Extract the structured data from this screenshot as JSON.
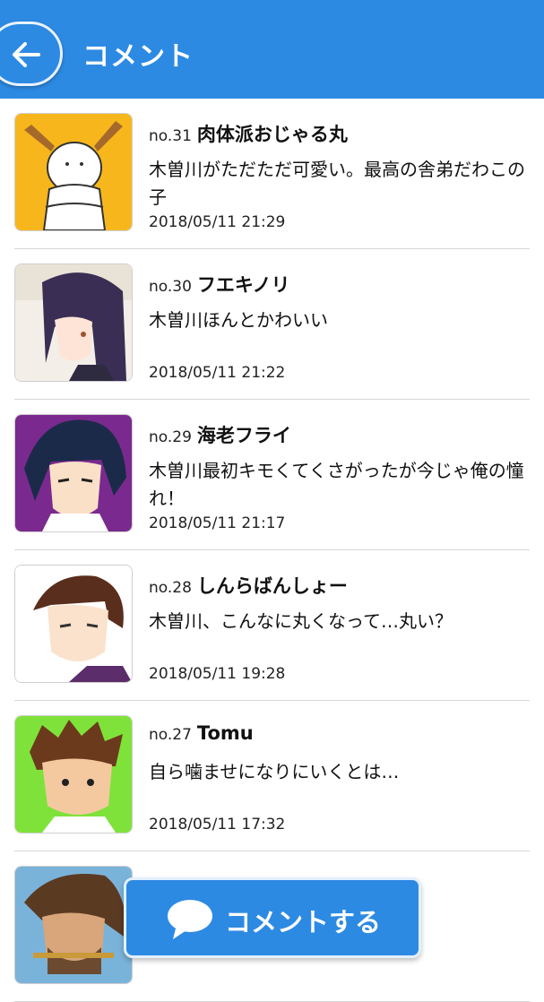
{
  "header": {
    "title": "コメント",
    "color": "#2d8ae3"
  },
  "comments": [
    {
      "number": "no.31",
      "user": "肉体派おじゃる丸",
      "text": "木曽川がただただ可愛い。最高の舎弟だわこの子",
      "date": "2018/05/11 21:29",
      "avatar": "horned-creature-avatar"
    },
    {
      "number": "no.30",
      "user": "フエキノリ",
      "text": "木曽川ほんとかわいい",
      "date": "2018/05/11 21:22",
      "avatar": "purple-hair-girl-avatar"
    },
    {
      "number": "no.29",
      "user": "海老フライ",
      "text": "木曽川最初キモくてくさがったが今じゃ俺の憧れ！",
      "date": "2018/05/11 21:17",
      "avatar": "dark-hair-boy-avatar"
    },
    {
      "number": "no.28",
      "user": "しんらばんしょー",
      "text": "木曽川、こんなに丸くなって…丸い？",
      "date": "2018/05/11 19:28",
      "avatar": "brown-hair-boy-avatar"
    },
    {
      "number": "no.27",
      "user": "Tomu",
      "text": "自ら噛ませになりにいくとは…",
      "date": "2018/05/11 17:32",
      "avatar": "spiky-hair-boy-avatar"
    },
    {
      "number": "",
      "user": "",
      "text": "",
      "date": "",
      "avatar": "bearded-man-avatar"
    }
  ],
  "comment_button": {
    "label": "コメントする"
  }
}
